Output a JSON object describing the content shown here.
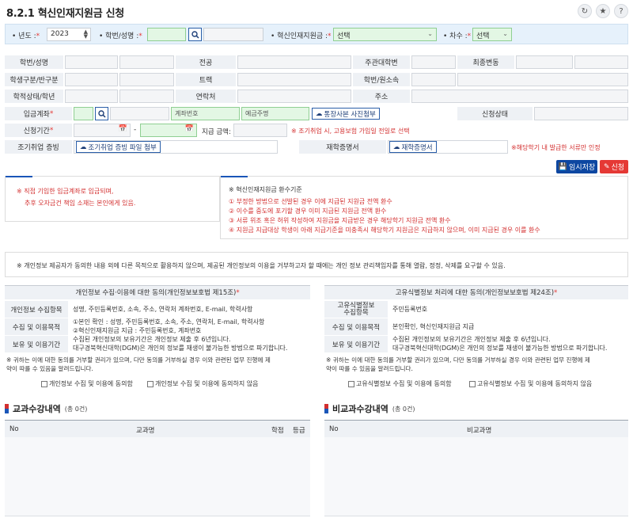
{
  "header": {
    "title": "8.2.1 혁신인재지원금 신청",
    "icons": [
      "refresh-icon",
      "star-icon",
      "help-icon"
    ]
  },
  "search": {
    "year_label": "년도",
    "year_value": "2023",
    "student_label": "학번/성명",
    "grant_label": "혁신인재지원금",
    "grant_value": "선택",
    "round_label": "차수",
    "round_value": "선택",
    "required_mark": "*"
  },
  "info": {
    "student_id_name": "학번/성명",
    "major": "전공",
    "main_major": "주관대학변",
    "last_change": "최종변동",
    "student_type": "학생구분/반구분",
    "track": "트랙",
    "dept": "학번/원소속",
    "status_grade": "학적상태/학년",
    "contact": "연락처",
    "address": "주소",
    "account_label": "입금계좌",
    "account_no_placeholder": "계좌번호",
    "account_holder_placeholder": "예금주명",
    "bankbook_btn": "통장사본 사진첨부",
    "apply_status": "신청상태",
    "period_label": "신청기간",
    "period_sep": "-",
    "amount_label": "지급 금액",
    "employment_warn": "※ 조기취업 시, 고용보험 가입일 전일로 선택",
    "early_proof_label": "조기취업 증빙",
    "early_proof_btn": "조기취업 증빙 파일 첨부",
    "enroll_cert_label": "재학증명서",
    "enroll_cert_btn": "재학증명서",
    "enroll_warn": "※해당학기 내 발급한 서류만 인정",
    "save_btn": "임시저장",
    "apply_btn": "신청"
  },
  "notice_left": {
    "line1": "※ 직접 기입한 입금계좌로 입금되며,",
    "line2": "추후 오자금건 책임 소재는 본인에게 있음."
  },
  "notice_right": {
    "heading": "※ 혁신인재지원금 환수기준",
    "lines": [
      "① 부정한 방법으로 선발된 경우 이에 지급된 지원금 전액 환수",
      "② 이수를 중도에 포기할 경우 이미 지급된 지원금 전액 환수",
      "③ 서류 위조 혹은 허위 작성하여 지원금을 지급받은 경우 해당학기 지원금 전액 환수",
      "④ 지원금 지급대상 학생이 아래 지급기준을 미충족시 해당학기 지원금은 지급하지 않으며, 이미 지급된 경우 이를 환수"
    ]
  },
  "privacy_notice": "※ 개인정보 제공자가 동의한 내용 외에 다른 목적으로 활용하지 않으며, 제공된 개인정보의 이용을 거부하고자 할 때에는 개인 정보 관리책임자를 통해 열람, 정정, 삭제를 요구할 수 있음.",
  "consent_left": {
    "title": "개인정보 수집·이용에 대한 동의(개인정보보호법 제15조)",
    "items_label": "개인정보 수집항목",
    "items_value": "성명, 주민등록번호, 소속, 주소, 연락처 계좌번호, E-mail, 학력사항",
    "purpose_label": "수집 및 이용목적",
    "purpose_line1": "①본인 확인 : 성명, 주민등록번호, 소속, 주소, 연락처, E-mail, 학력사항",
    "purpose_line2": "②혁신인재지원금 지급 : 주민등록번호, 계좌번호",
    "period_label": "보유 및 이용기간",
    "period_line1": "수집된 개인정보의 보유기간은 개인정보 제출 후 6년입니다.",
    "period_line2": "대구경북혁신대학(DGM)은 개인의 정보를 재생이 불가능한 방법으로 파기합니다.",
    "note_line1": "※ 귀하는 이에 대한 동의를 거부할 권리가 있으며, 다만 동의를 거부하실 경우 이와 관련된 업무 진행에 제",
    "note_line2": "약이 따를 수 있음을 알려드립니다.",
    "agree": "개인정보 수집 및 이용에 동의함",
    "disagree": "개인정보 수집 및 이용에 동의하지 않음"
  },
  "consent_right": {
    "title": "고유식별정보 처리에 대한 동의(개인정보보호법 제24조)",
    "items_label_1": "고유식별정보",
    "items_label_2": "수집항목",
    "items_value": "주민등록번호",
    "purpose_label": "수집 및 이용목적",
    "purpose_value": "본인확인, 혁신인재지원금 지급",
    "period_label": "보유 및 이용기간",
    "period_line1": "수집된 개인정보의 보유기간은 개인정보 제출 후 6년입니다.",
    "period_line2": "대구경북혁신대학(DGM)은 개인의 정보를 재생이 불가능한 방법으로 파기합니다.",
    "note_line1": "※ 귀하는 이에 대한 동의를 거부할 권리가 있으며, 다만 동의를 거부하실 경우 이와 관련된 업무 진행에 제",
    "note_line2": "약이 따를 수 있음을 알려드립니다.",
    "agree": "고유식별정보 수집 및 이용에 동의함",
    "disagree": "고유식별정보 수집 및 이용에 동의하지 않음"
  },
  "courses": {
    "title": "교과수강내역",
    "count": "(총 0건)",
    "col_no": "No",
    "col_name": "교과명",
    "col_credit": "학점",
    "col_grade": "등급"
  },
  "noncourses": {
    "title": "비교과수강내역",
    "count": "(총 0건)",
    "col_no": "No",
    "col_name": "비교과명"
  },
  "colors": {
    "accent_blue": "#1a56b8",
    "warn_red": "#d32f2f",
    "apply_red": "#e53935",
    "save_navy": "#0d47a1",
    "search_bg": "#e6f1fb"
  }
}
